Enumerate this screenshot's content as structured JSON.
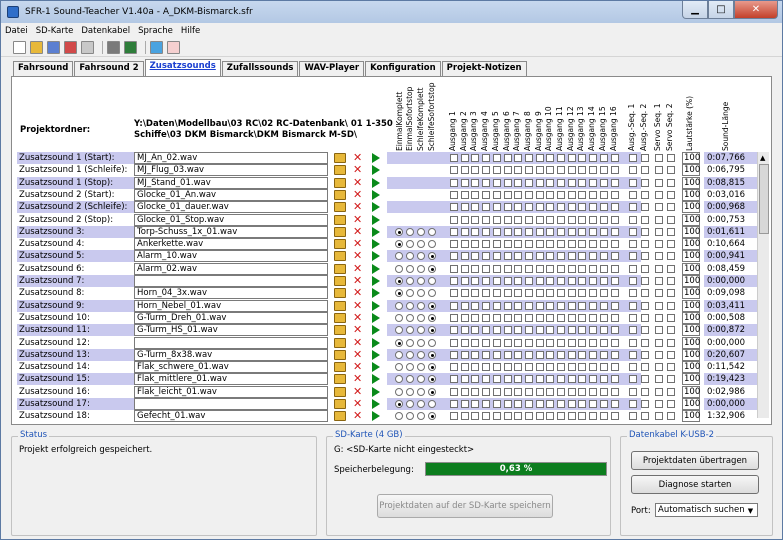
{
  "window": {
    "title": "SFR-1 Sound-Teacher V1.40a - A_DKM-Bismarck.sfr"
  },
  "menu": [
    "Datei",
    "SD-Karte",
    "Datenkabel",
    "Sprache",
    "Hilfe"
  ],
  "tabs": [
    "Fahrsound",
    "Fahrsound 2",
    "Zusatzsounds",
    "Zufallssounds",
    "WAV-Player",
    "Konfiguration",
    "Projekt-Notizen"
  ],
  "active_tab": "Zusatzsounds",
  "project": {
    "label": "Projektordner:",
    "path_line1": "Y:\\Daten\\Modellbau\\03 RC\\02 RC-Datenbank\\ 01 1-350",
    "path_line2": "Schiffe\\03 DKM Bismarck\\DKM Bismarck M-SD\\"
  },
  "column_headers": {
    "modes": [
      "EinmalKomplett",
      "EinmalSofortstop",
      "SchleifeKomplett",
      "SchleifeSofortstop"
    ],
    "outputs": [
      "Ausgang 1",
      "Ausgang 2",
      "Ausgang 3",
      "Ausgang 4",
      "Ausgang 5",
      "Ausgang 6",
      "Ausgang 7",
      "Ausgang 8",
      "Ausgang 9",
      "Ausgang 10",
      "Ausgang 11",
      "Ausgang 12",
      "Ausgang 13",
      "Ausgang 14",
      "Ausgang 15",
      "Ausgang 16"
    ],
    "seq": [
      "Ausg.-Seq. 1",
      "Ausg.-Seq. 2",
      "Servo Seq. 1",
      "Servo Seq. 2"
    ],
    "volume": "Lautstärke (%)",
    "length": "Sound-Länge"
  },
  "rows": [
    {
      "label": "Zusatzsound 1 (Start):",
      "file": "MJ_An_02.wav",
      "mode": -1,
      "volume": "100",
      "length": "0:07,766"
    },
    {
      "label": "Zusatzsound 1 (Schleife):",
      "file": "MJ_Flug_03.wav",
      "mode": -1,
      "volume": "100",
      "length": "0:06,795"
    },
    {
      "label": "Zusatzsound 1 (Stop):",
      "file": "MJ_Stand_01.wav",
      "mode": -1,
      "volume": "100",
      "length": "0:08,815"
    },
    {
      "label": "Zusatzsound 2 (Start):",
      "file": "Glocke_01_An.wav",
      "mode": -1,
      "volume": "100",
      "length": "0:03,016"
    },
    {
      "label": "Zusatzsound 2 (Schleife):",
      "file": "Glocke_01_dauer.wav",
      "mode": -1,
      "volume": "100",
      "length": "0:00,968"
    },
    {
      "label": "Zusatzsound 2 (Stop):",
      "file": "Glocke_01_Stop.wav",
      "mode": -1,
      "volume": "100",
      "length": "0:00,753"
    },
    {
      "label": "Zusatzsound 3:",
      "file": "Torp-Schuss_1x_01.wav",
      "mode": 0,
      "volume": "100",
      "length": "0:01,611"
    },
    {
      "label": "Zusatzsound 4:",
      "file": "Ankerkette.wav",
      "mode": 0,
      "volume": "100",
      "length": "0:10,664"
    },
    {
      "label": "Zusatzsound 5:",
      "file": "Alarm_10.wav",
      "mode": 3,
      "volume": "100",
      "length": "0:00,941"
    },
    {
      "label": "Zusatzsound 6:",
      "file": "Alarm_02.wav",
      "mode": 3,
      "volume": "100",
      "length": "0:08,459"
    },
    {
      "label": "Zusatzsound 7:",
      "file": "",
      "mode": 0,
      "volume": "100",
      "length": "0:00,000"
    },
    {
      "label": "Zusatzsound 8:",
      "file": "Horn_04_3x.wav",
      "mode": 0,
      "volume": "100",
      "length": "0:09,098"
    },
    {
      "label": "Zusatzsound 9:",
      "file": "Horn_Nebel_01.wav",
      "mode": 3,
      "volume": "100",
      "length": "0:03,411"
    },
    {
      "label": "Zusatzsound 10:",
      "file": "G-Turm_Dreh_01.wav",
      "mode": 3,
      "volume": "100",
      "length": "0:00,508"
    },
    {
      "label": "Zusatzsound 11:",
      "file": "G-Turm_HS_01.wav",
      "mode": 3,
      "volume": "100",
      "length": "0:00,872"
    },
    {
      "label": "Zusatzsound 12:",
      "file": "",
      "mode": 0,
      "volume": "100",
      "length": "0:00,000"
    },
    {
      "label": "Zusatzsound 13:",
      "file": "G-Turm_8x38.wav",
      "mode": 3,
      "volume": "100",
      "length": "0:20,607"
    },
    {
      "label": "Zusatzsound 14:",
      "file": "Flak_schwere_01.wav",
      "mode": 3,
      "volume": "100",
      "length": "0:11,542"
    },
    {
      "label": "Zusatzsound 15:",
      "file": "Flak_mittlere_01.wav",
      "mode": 3,
      "volume": "100",
      "length": "0:19,423"
    },
    {
      "label": "Zusatzsound 16:",
      "file": "Flak_leicht_01.wav",
      "mode": 3,
      "volume": "100",
      "length": "0:02,986"
    },
    {
      "label": "Zusatzsound 17:",
      "file": "",
      "mode": 0,
      "volume": "100",
      "length": "0:00,000"
    },
    {
      "label": "Zusatzsound 18:",
      "file": "Gefecht_01.wav",
      "mode": 3,
      "volume": "100",
      "length": "1:32,906"
    }
  ],
  "status": {
    "title": "Status",
    "text": "Projekt erfolgreich gespeichert."
  },
  "sd": {
    "title": "SD-Karte (4 GB)",
    "drive": "G: <SD-Karte nicht eingesteckt>",
    "usage_label": "Speicherbelegung:",
    "usage_text": "0,63 %",
    "usage_value": 0.63,
    "save_button": "Projektdaten auf der SD-Karte speichern"
  },
  "cable": {
    "title": "Datenkabel K-USB-2",
    "transfer_button": "Projektdaten übertragen",
    "diag_button": "Diagnose starten",
    "port_label": "Port:",
    "port_value": "Automatisch suchen"
  },
  "colors": {
    "accent": "#1f54b7",
    "row_highlight": "#c9c9ee",
    "progress": "#0c7d1e"
  }
}
